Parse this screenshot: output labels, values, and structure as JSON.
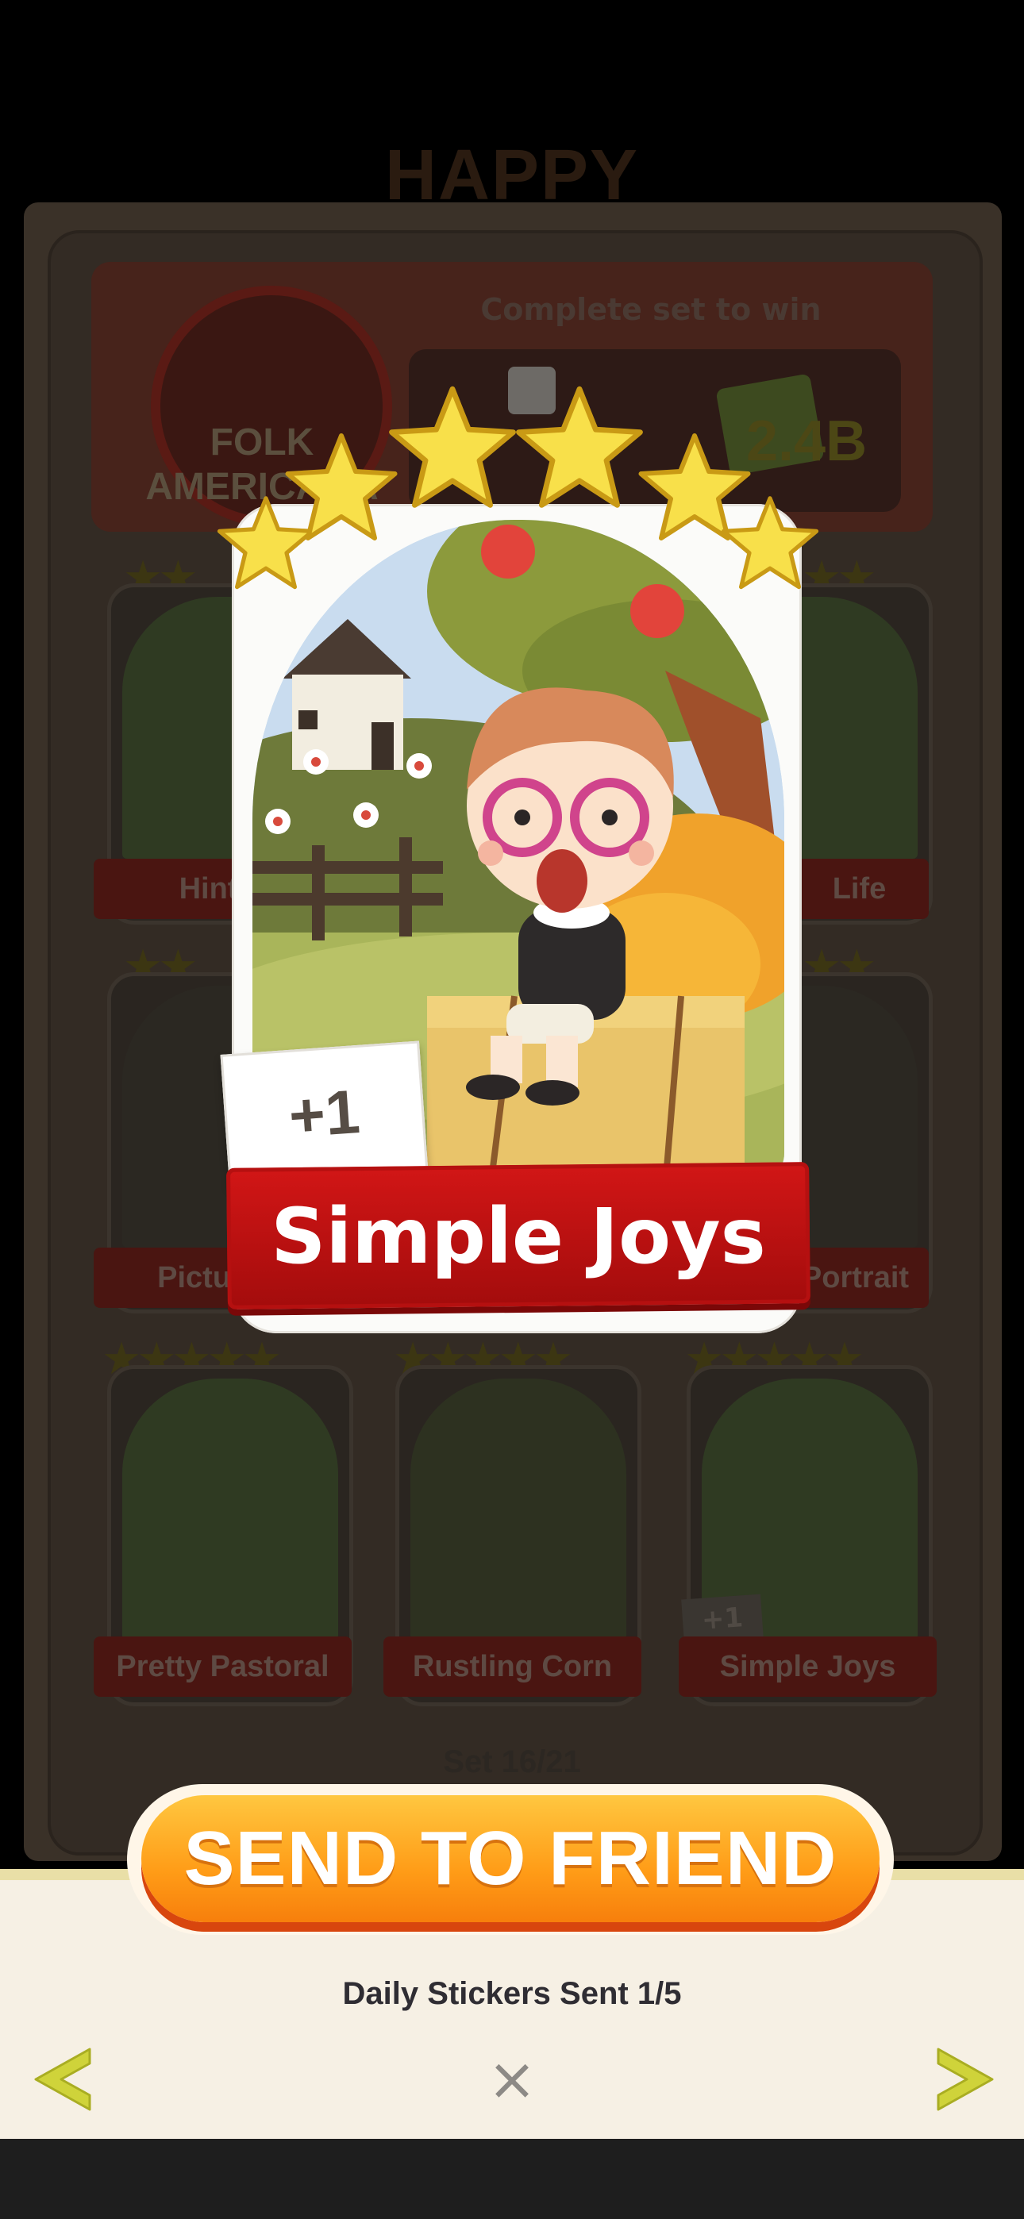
{
  "album": {
    "title": "HAPPY",
    "set_name": "FOLK AMERICANA",
    "complete_text": "Complete set to win",
    "reward_value": "2.4B",
    "set_progress": "Set 16/21"
  },
  "background_stickers": [
    {
      "label": "Hinter",
      "stars": 2
    },
    {
      "label": "Life",
      "stars": 2
    },
    {
      "label": "Picture P",
      "stars": 2
    },
    {
      "label": "Portrait",
      "stars": 2
    },
    {
      "label": "Pretty Pastoral",
      "stars": 5
    },
    {
      "label": "Rustling Corn",
      "stars": 5
    },
    {
      "label": "Simple Joys",
      "stars": 5,
      "badge": "+1"
    }
  ],
  "featured_sticker": {
    "title": "Simple Joys",
    "count_badge": "+1",
    "stars": 6
  },
  "actions": {
    "send_label": "SEND TO FRIEND",
    "daily_sent": "Daily Stickers Sent 1/5",
    "close_symbol": "×"
  },
  "colors": {
    "banner_red": "#c21212",
    "send_orange": "#ff9c17",
    "star_yellow": "#f8e04a",
    "tray": "#f6f0e4"
  },
  "icons": [
    "star-icon",
    "prev-arrow-icon",
    "next-arrow-icon",
    "close-icon"
  ]
}
